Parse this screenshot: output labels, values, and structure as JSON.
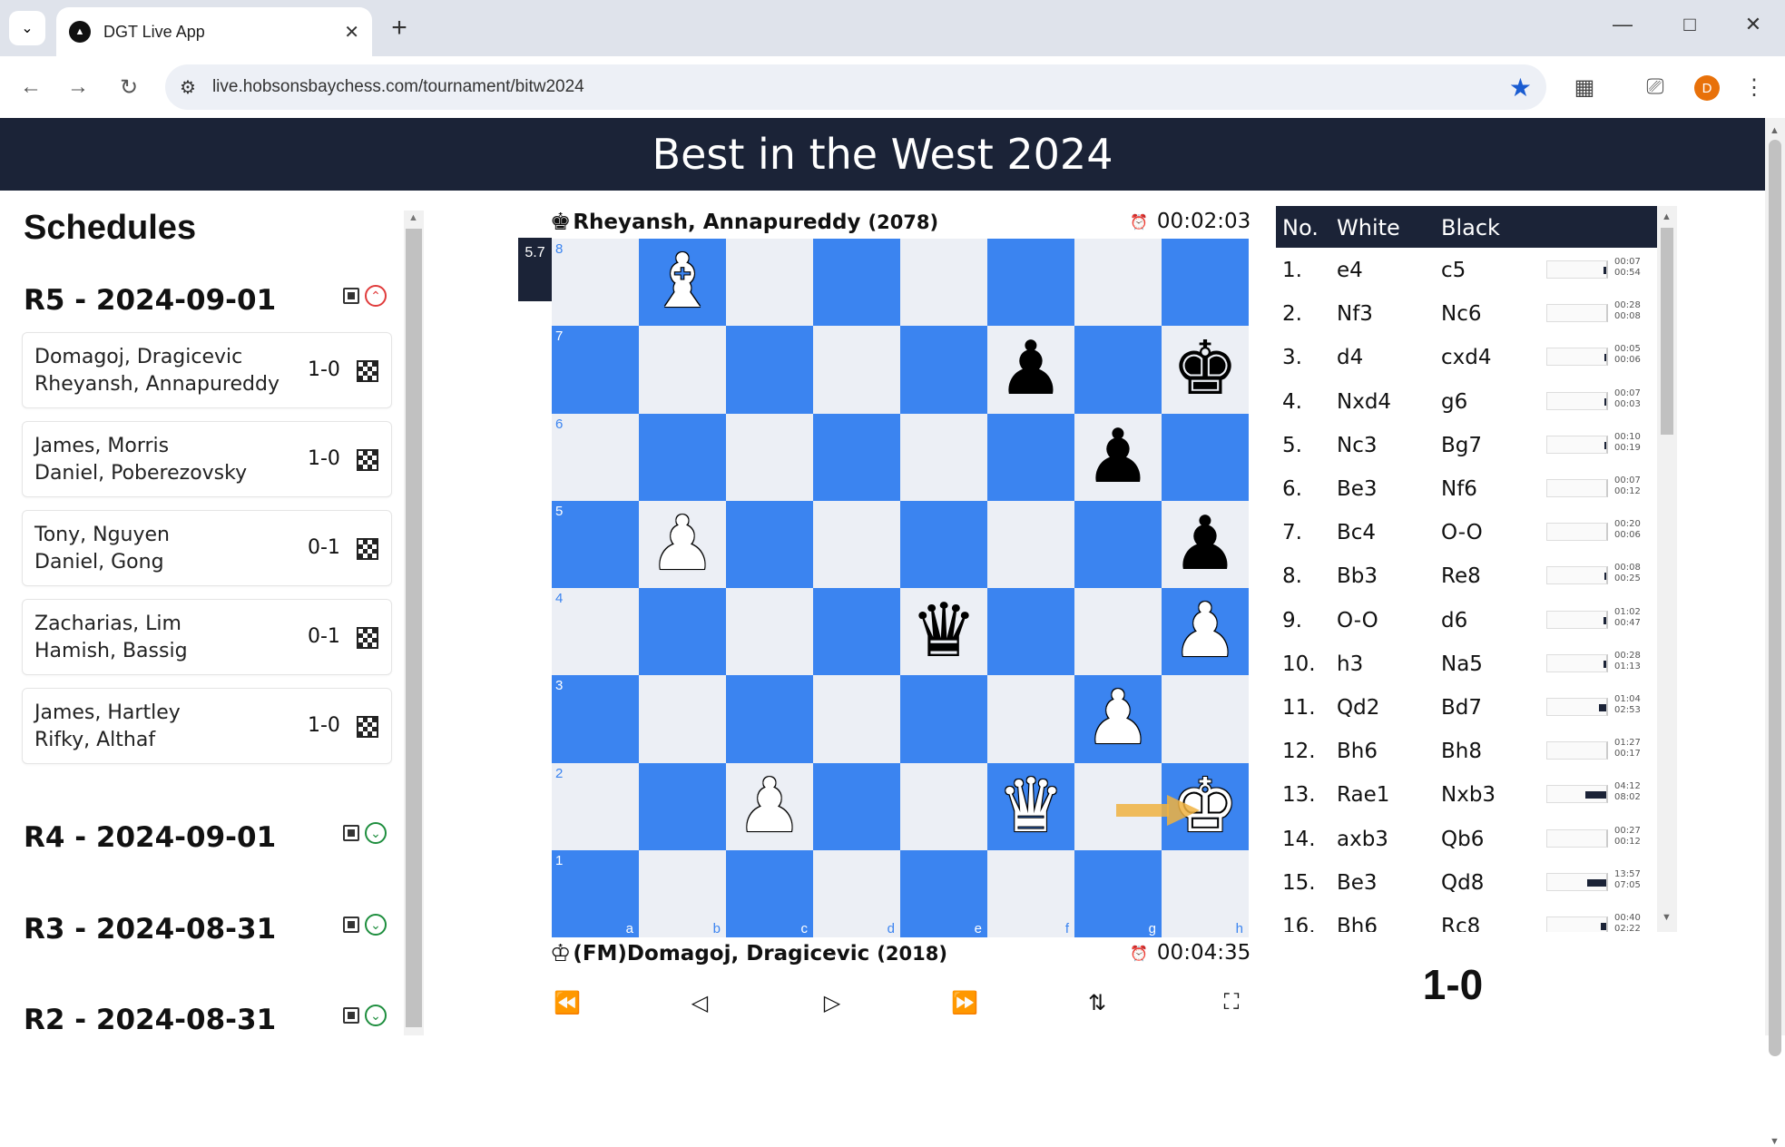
{
  "browser": {
    "tab_title": "DGT Live App",
    "url": "live.hobsonsbaychess.com/tournament/bitw2024",
    "profile_initial": "D"
  },
  "page": {
    "title": "Best in the West 2024"
  },
  "sidebar": {
    "title": "Schedules",
    "rounds": [
      {
        "label": "R5 - 2024-09-01",
        "expanded": true
      },
      {
        "label": "R4 - 2024-09-01",
        "expanded": false
      },
      {
        "label": "R3 - 2024-08-31",
        "expanded": false
      },
      {
        "label": "R2 - 2024-08-31",
        "expanded": false
      }
    ],
    "games": [
      {
        "white": "Domagoj, Dragicevic",
        "black": "Rheyansh, Annapureddy",
        "result": "1-0"
      },
      {
        "white": "James, Morris",
        "black": "Daniel, Poberezovsky",
        "result": "1-0"
      },
      {
        "white": "Tony, Nguyen",
        "black": "Daniel, Gong",
        "result": "0-1"
      },
      {
        "white": "Zacharias, Lim",
        "black": "Hamish, Bassig",
        "result": "0-1"
      },
      {
        "white": "James, Hartley",
        "black": "Rifky, Althaf",
        "result": "1-0"
      }
    ]
  },
  "game": {
    "eval": "5.7",
    "top_player": {
      "name": "Rheyansh, Annapureddy",
      "rating": "(2078)",
      "clock": "00:02:03"
    },
    "bottom_player": {
      "name": "(FM)Domagoj, Dragicevic",
      "rating": "(2018)",
      "clock": "00:04:35"
    },
    "result": "1-0",
    "board": [
      [
        "",
        "B",
        "",
        "",
        "",
        "",
        "",
        ""
      ],
      [
        "",
        "",
        "",
        "",
        "",
        "p",
        "",
        "k"
      ],
      [
        "",
        "",
        "",
        "",
        "",
        "",
        "p",
        ""
      ],
      [
        "",
        "P",
        "",
        "",
        "",
        "",
        "",
        "p"
      ],
      [
        "",
        "",
        "",
        "",
        "q",
        "",
        "",
        "P"
      ],
      [
        "",
        "",
        "",
        "",
        "",
        "",
        "P",
        ""
      ],
      [
        "",
        "",
        "P",
        "",
        "",
        "Q",
        "",
        "K"
      ],
      [
        "",
        "",
        "",
        "",
        "",
        "",
        "",
        ""
      ]
    ],
    "files": [
      "a",
      "b",
      "c",
      "d",
      "e",
      "f",
      "g",
      "h"
    ],
    "ranks": [
      "8",
      "7",
      "6",
      "5",
      "4",
      "3",
      "2",
      "1"
    ],
    "last_move_arrow": {
      "from": "g2",
      "to": "h2",
      "color": "#f0b13f"
    }
  },
  "movelist": {
    "headers": {
      "no": "No.",
      "white": "White",
      "black": "Black"
    },
    "moves": [
      {
        "no": "1.",
        "white": "e4",
        "black": "c5",
        "wt": "00:07",
        "bt": "00:54",
        "bar": 0.04
      },
      {
        "no": "2.",
        "white": "Nf3",
        "black": "Nc6",
        "wt": "00:28",
        "bt": "00:08",
        "bar": 0.0
      },
      {
        "no": "3.",
        "white": "d4",
        "black": "cxd4",
        "wt": "00:05",
        "bt": "00:06",
        "bar": 0.02
      },
      {
        "no": "4.",
        "white": "Nxd4",
        "black": "g6",
        "wt": "00:07",
        "bt": "00:03",
        "bar": 0.02
      },
      {
        "no": "5.",
        "white": "Nc3",
        "black": "Bg7",
        "wt": "00:10",
        "bt": "00:19",
        "bar": 0.02
      },
      {
        "no": "6.",
        "white": "Be3",
        "black": "Nf6",
        "wt": "00:07",
        "bt": "00:12",
        "bar": 0.0
      },
      {
        "no": "7.",
        "white": "Bc4",
        "black": "O-O",
        "wt": "00:20",
        "bt": "00:06",
        "bar": 0.0
      },
      {
        "no": "8.",
        "white": "Bb3",
        "black": "Re8",
        "wt": "00:08",
        "bt": "00:25",
        "bar": 0.02
      },
      {
        "no": "9.",
        "white": "O-O",
        "black": "d6",
        "wt": "01:02",
        "bt": "00:47",
        "bar": 0.04
      },
      {
        "no": "10.",
        "white": "h3",
        "black": "Na5",
        "wt": "00:28",
        "bt": "01:13",
        "bar": 0.04
      },
      {
        "no": "11.",
        "white": "Qd2",
        "black": "Bd7",
        "wt": "01:04",
        "bt": "02:53",
        "bar": 0.12
      },
      {
        "no": "12.",
        "white": "Bh6",
        "black": "Bh8",
        "wt": "01:27",
        "bt": "00:17",
        "bar": 0.0
      },
      {
        "no": "13.",
        "white": "Rae1",
        "black": "Nxb3",
        "wt": "04:12",
        "bt": "08:02",
        "bar": 0.36
      },
      {
        "no": "14.",
        "white": "axb3",
        "black": "Qb6",
        "wt": "00:27",
        "bt": "00:12",
        "bar": 0.0
      },
      {
        "no": "15.",
        "white": "Be3",
        "black": "Qd8",
        "wt": "13:57",
        "bt": "07:05",
        "bar": 0.32
      },
      {
        "no": "16.",
        "white": "Bh6",
        "black": "Rc8",
        "wt": "00:40",
        "bt": "02:22",
        "bar": 0.1
      }
    ]
  }
}
